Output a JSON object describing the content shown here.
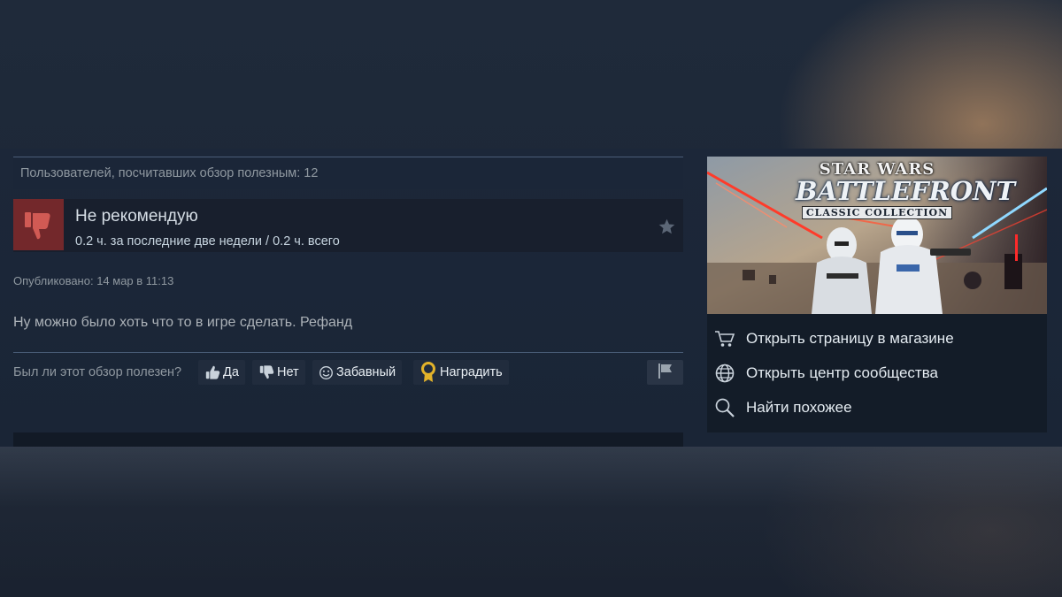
{
  "review": {
    "helpful_count_text": "Пользователей, посчитавших обзор полезным: 12",
    "verdict": "Не рекомендую",
    "hours": "0.2 ч. за последние две недели / 0.2 ч. всего",
    "posted": "Опубликовано: 14 мар в 11:13",
    "text": "Ну можно было хоть что то в игре сделать. Рефанд"
  },
  "vote": {
    "question": "Был ли этот обзор полезен?",
    "yes_label": "Да",
    "no_label": "Нет",
    "funny_label": "Забавный",
    "award_label": "Наградить"
  },
  "game": {
    "logo_top": "STAR WARS",
    "logo_title": "BATTLEFRONT",
    "logo_subtitle": "CLASSIC COLLECTION",
    "links": [
      {
        "label": "Открыть страницу в магазине",
        "icon": "cart-icon"
      },
      {
        "label": "Открыть центр сообщества",
        "icon": "globe-icon"
      },
      {
        "label": "Найти похожее",
        "icon": "search-icon"
      }
    ]
  },
  "colors": {
    "not_recommended": "#73282b",
    "award_gold": "#e3b32a",
    "background": "#1b2636"
  }
}
